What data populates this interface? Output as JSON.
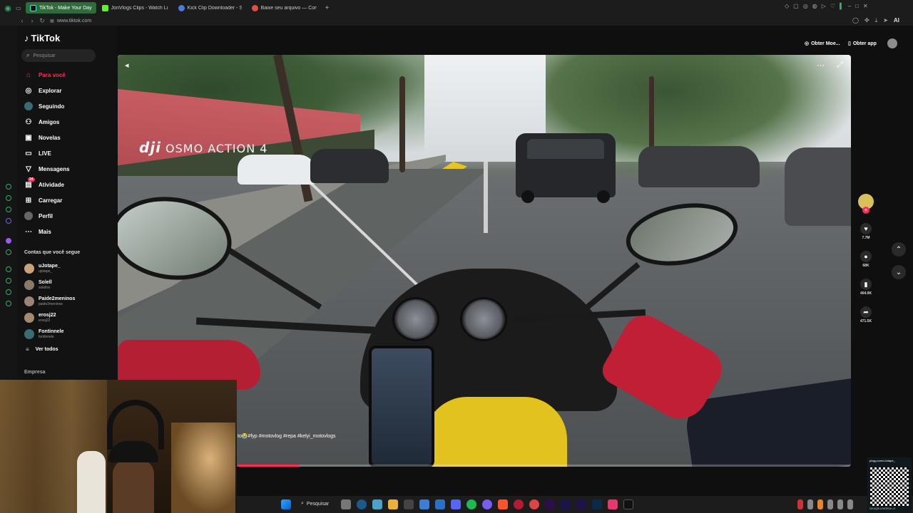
{
  "browser": {
    "tabs": [
      {
        "label": "TikTok - Make Your Day",
        "active": true,
        "color": "#25f4ee"
      },
      {
        "label": "JonVlogs Clips - Watch Li...",
        "active": false,
        "color": "#53fc18"
      },
      {
        "label": "Kick Clip Downloader - Sh...",
        "active": false,
        "color": "#4a7bd8"
      },
      {
        "label": "Baixe seu arquivo — Conv...",
        "active": false,
        "color": "#e74c3c"
      }
    ],
    "url": "www.tiktok.com",
    "ai_label": "AI"
  },
  "tiktok": {
    "logo": "TikTok",
    "search_placeholder": "Pesquisar",
    "nav": [
      {
        "label": "Para você",
        "icon": "home-icon",
        "active": true
      },
      {
        "label": "Explorar",
        "icon": "compass-icon",
        "active": false
      },
      {
        "label": "Seguindo",
        "icon": "following-icon",
        "active": false
      },
      {
        "label": "Amigos",
        "icon": "friends-icon",
        "active": false
      },
      {
        "label": "Novelas",
        "icon": "novelas-icon",
        "active": false
      },
      {
        "label": "LIVE",
        "icon": "live-icon",
        "active": false
      },
      {
        "label": "Mensagens",
        "icon": "messages-icon",
        "active": false
      },
      {
        "label": "Atividade",
        "icon": "activity-icon",
        "active": false,
        "badge": "24"
      },
      {
        "label": "Carregar",
        "icon": "upload-icon",
        "active": false
      },
      {
        "label": "Perfil",
        "icon": "profile-icon",
        "active": false
      },
      {
        "label": "Mais",
        "icon": "more-icon",
        "active": false
      }
    ],
    "following_title": "Contas que você segue",
    "following": [
      {
        "name": "uJotape_",
        "handle": "ujotape_"
      },
      {
        "name": "Solell",
        "handle": "solellsv"
      },
      {
        "name": "Paide2meninos",
        "handle": "paide2meninos"
      },
      {
        "name": "erosj22",
        "handle": "erosj22"
      },
      {
        "name": "Fontinnele",
        "handle": "fontinnele"
      }
    ],
    "see_all": "Ver todos",
    "company": "Empresa",
    "header": {
      "coins": "Obter Moe...",
      "get_app": "Obter app"
    },
    "video": {
      "watermark_brand": "dji",
      "watermark_text": "OSMO ACTION 4",
      "caption": "to😭#fyp #motovlog #repa #kelyi_motovlogs",
      "progress": 0.1
    },
    "actions": {
      "likes": "7.7M",
      "comments": "68K",
      "saves": "404.9K",
      "shares": "471.5K"
    }
  },
  "taskbar": {
    "search_label": "Pesquisar"
  },
  "overlay": {
    "qr_url": "pixgg.com/uJotape_",
    "qr_caption": "DÁ AQUI A MOEDA <3"
  },
  "colors": {
    "accent": "#fe2c55",
    "tab_active": "#2f6b3b",
    "strip_icons": "#2fb36a"
  }
}
